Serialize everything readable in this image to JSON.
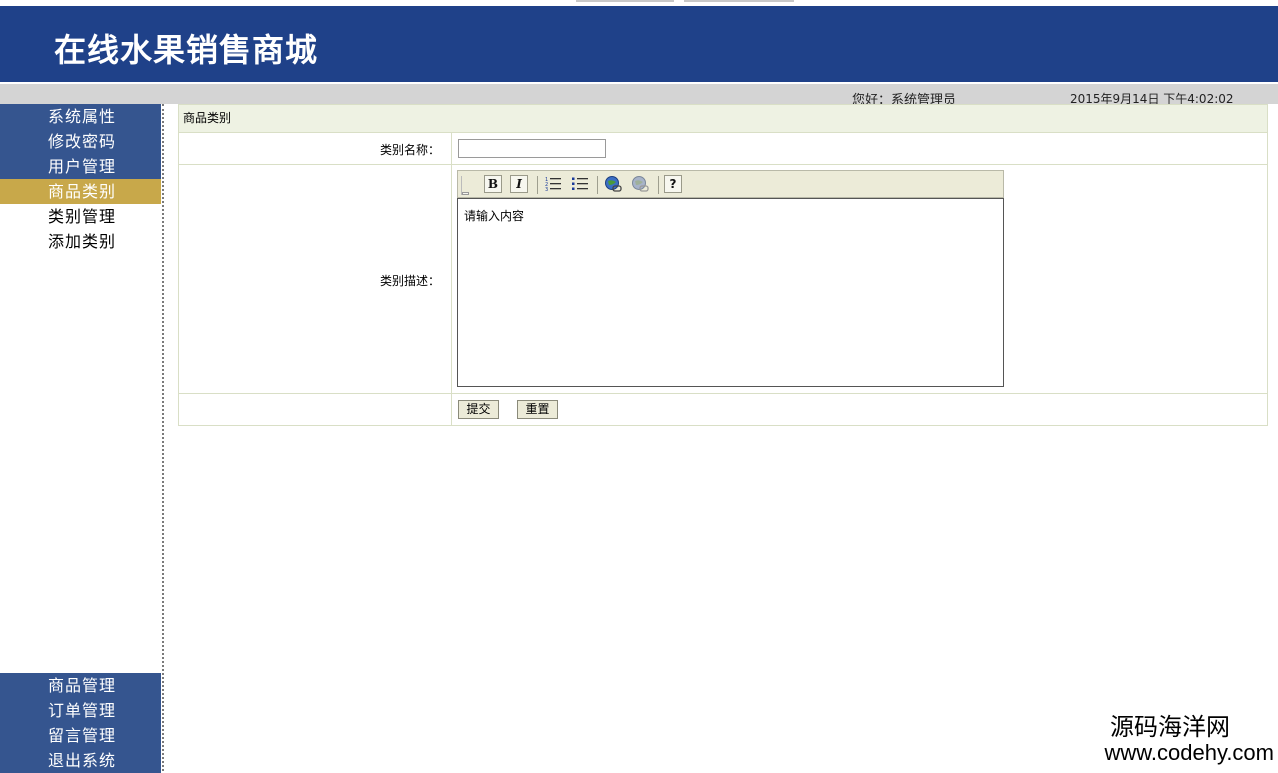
{
  "header": {
    "title": "在线水果销售商城"
  },
  "infobar": {
    "greeting": "您好：系统管理员",
    "datetime": "2015年9月14日  下午4:02:02"
  },
  "sidebar": {
    "top_items": [
      {
        "label": "系统属性"
      },
      {
        "label": "修改密码"
      },
      {
        "label": "用户管理"
      },
      {
        "label": "商品类别"
      },
      {
        "label": "类别管理"
      },
      {
        "label": "添加类别"
      }
    ],
    "bottom_items": [
      {
        "label": "商品管理"
      },
      {
        "label": "订单管理"
      },
      {
        "label": "留言管理"
      },
      {
        "label": "退出系统"
      }
    ]
  },
  "form": {
    "caption": "商品类别",
    "name_label": "类别名称：",
    "name_value": "",
    "desc_label": "类别描述：",
    "editor_content": "请输入内容",
    "toolbar": {
      "bold": "B",
      "italic": "I",
      "help": "?"
    },
    "submit_label": "提交",
    "reset_label": "重置"
  },
  "watermark": {
    "cn": "源码海洋网",
    "en": "www.codehy.com"
  },
  "colors": {
    "header_bg": "#1f4189",
    "menu_bg": "#35558f",
    "menu_active": "#c8a84a",
    "caption_bg": "#eef2e3"
  }
}
